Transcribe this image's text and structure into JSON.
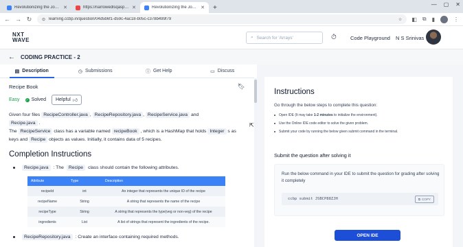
{
  "browser": {
    "tabs": [
      {
        "title": "Revolutionizing the Job Marke",
        "active": false,
        "favicon_color": "#3b82f6"
      },
      {
        "title": "https://narrowedlsqasps28e",
        "active": false,
        "favicon_color": "#ef4444"
      },
      {
        "title": "Revolutionizing the Job Marke",
        "active": true,
        "favicon_color": "#3b82f6"
      }
    ],
    "new_tab": "+",
    "url": "learning.ccbp.in/question/04d5b6f1-d59c-4ac18-b05c-c378b499f79",
    "window_controls": [
      "—",
      "▢",
      "✕"
    ]
  },
  "header": {
    "logo_line1": "NXT",
    "logo_line2": "WAVE",
    "search_placeholder": "Search for 'Arrays'",
    "code_playground": "Code Playground",
    "user_name": "N S Srinivas"
  },
  "practice": {
    "title": "CODING PRACTICE - 2"
  },
  "left_tabs": [
    {
      "label": "Description",
      "icon": "document-icon",
      "active": true
    },
    {
      "label": "Submissions",
      "icon": "clock-icon",
      "active": false
    },
    {
      "label": "Get Help",
      "icon": "help-icon",
      "active": false
    },
    {
      "label": "Discuss",
      "icon": "discuss-icon",
      "active": false
    }
  ],
  "problem": {
    "title": "Recipe Book",
    "difficulty": "Easy",
    "status": "Solved",
    "helpful": "Helpful",
    "intro": {
      "given": "Given four files",
      "file1": "RecipeController.java",
      "sep1": ",",
      "file2": "RecipeRepository.java",
      "sep2": ",",
      "file3": "RecipeService.java",
      "and": "and",
      "file4": "Recipe.java",
      "end": "."
    },
    "line2": {
      "the": "The",
      "code1": "RecipeService",
      "t1": "class has a variable named",
      "code2": "recipeBook",
      "t2": ", which is a HashMap that holds",
      "code3": "Integer",
      "t3": "s as"
    },
    "line3": {
      "t1": "keys and",
      "code1": "Recipe",
      "t2": "objects as values. Initially, it contains data of 5 recipes."
    },
    "completion_heading": "Completion Instructions",
    "bullet1": {
      "code1": "Recipe.java",
      "t1": ": The",
      "code2": "Recipe",
      "t2": "class should contain the following attributes."
    },
    "table": {
      "headers": [
        "Attribute",
        "Type",
        "Description"
      ],
      "rows": [
        [
          "recipeId",
          "int",
          "An integer that represents the unique ID of the recipe"
        ],
        [
          "recipeName",
          "String",
          "A string that represents the name of the recipe"
        ],
        [
          "recipeType",
          "String",
          "A string that represents the type(veg or non-veg) of the recipe"
        ],
        [
          "ingredients",
          "List",
          "A list of strings that represent the ingredients of the recipe."
        ]
      ]
    },
    "bullet2": {
      "code1": "RecipeRepository.java",
      "t1": ": Create an interface containing required methods."
    }
  },
  "instructions": {
    "heading": "Instructions",
    "intro": "Go through the below steps to complete this question:",
    "steps": [
      {
        "before": "Open IDE (It may take ",
        "bold": "1-2 minutes",
        "after": " to initialize the environment)."
      },
      {
        "before": "Use the Online IDE code editor to solve the given problem.",
        "bold": "",
        "after": ""
      },
      {
        "before": "Submit your code by running the below given submit command in the terminal.",
        "bold": "",
        "after": ""
      }
    ],
    "submit_heading": "Submit the question after solving it",
    "submit_desc": "Run the below command in your IDE to submit the question for grading after solving it completely",
    "command": "ccbp submit JSBCP88ZJH",
    "copy_label": "COPY",
    "open_ide": "OPEN IDE"
  },
  "colors": {
    "accent": "#2563eb",
    "table_header": "#3b82f6",
    "easy": "#16a34a",
    "open_ide_button": "#1d4ed8"
  }
}
